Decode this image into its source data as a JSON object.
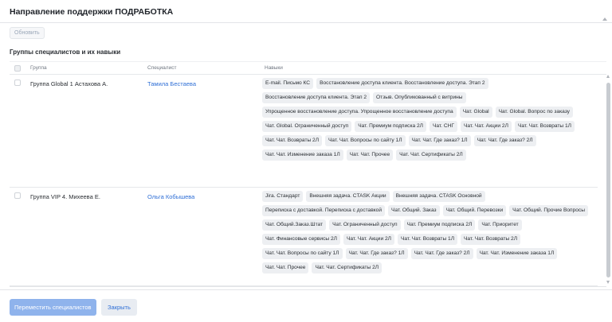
{
  "dialog": {
    "title": "Направление поддержки ПОДРАБОТКА",
    "refresh_label": "Обновить",
    "section_title": "Группы специалистов и их навыки"
  },
  "table": {
    "columns": [
      "Группа",
      "Специалист",
      "Навыки"
    ],
    "rows": [
      {
        "group": "Группа Global 1 Астахова А.",
        "specialist": "Тамила Бестаева",
        "skills": [
          "E-mail. Письмо КС",
          "Восстановление доступа клиента. Восстановление доступа. Этап 2",
          "Восстановление доступа клиента. Этап 2",
          "Отзыв. Опубликованный с витрины",
          "Упрощенное восстановление доступа. Упрощенное восстановление доступа",
          "Чат. Global",
          "Чат. Global. Вопрос по заказу",
          "Чат. Global. Ограниченный доступ",
          "Чат. Премиум подписка 2Л",
          "Чат. СНГ",
          "Чат. Чат. Акции 2Л",
          "Чат. Чат. Возвраты 1Л",
          "Чат. Чат. Возвраты 2Л",
          "Чат. Чат. Вопросы по сайту 1Л",
          "Чат. Чат. Где заказ? 1Л",
          "Чат. Чат. Где заказ? 2Л",
          "Чат. Чат. Изменение заказа 1Л",
          "Чат. Чат. Прочее",
          "Чат. Чат. Сертификаты 2Л"
        ]
      },
      {
        "group": "Группа VIP 4. Михеева Е.",
        "specialist": "Ольга Кобышева",
        "skills": [
          "Jira. Стандарт",
          "Внешняя задача. CTASK Акции",
          "Внешняя задача. CTASK Основной",
          "Переписка с доставкой. Переписка с доставкой",
          "Чат. Общий. Заказ",
          "Чат. Общий. Перевозки",
          "Чат. Общий. Прочие Вопросы",
          "Чат. Общий.Заказ.Штат",
          "Чат. Ограниченный доступ",
          "Чат. Премиум подписка 2Л",
          "Чат. Приоритет",
          "Чат. Финансовые сервисы 2Л",
          "Чат. Чат. Акции 2Л",
          "Чат. Чат. Возвраты 1Л",
          "Чат. Чат. Возвраты 2Л",
          "Чат. Чат. Вопросы по сайту 1Л",
          "Чат. Чат. Где заказ? 1Л",
          "Чат. Чат. Где заказ? 2Л",
          "Чат. Чат. Изменение заказа 1Л",
          "Чат. Чат. Прочее",
          "Чат. Чат. Сертификаты 2Л"
        ]
      }
    ]
  },
  "footer": {
    "move_label": "Переместить специалистов",
    "close_label": "Закрыть"
  },
  "colors": {
    "accent": "#2f6fd6",
    "primary_button_disabled": "#8fb3ec",
    "chip_background": "#edeff2"
  },
  "icons": {
    "header_scroll": "chevron-up-icon",
    "scroll_up": "scroll-up-arrow-icon",
    "scroll_down": "scroll-down-arrow-icon"
  }
}
